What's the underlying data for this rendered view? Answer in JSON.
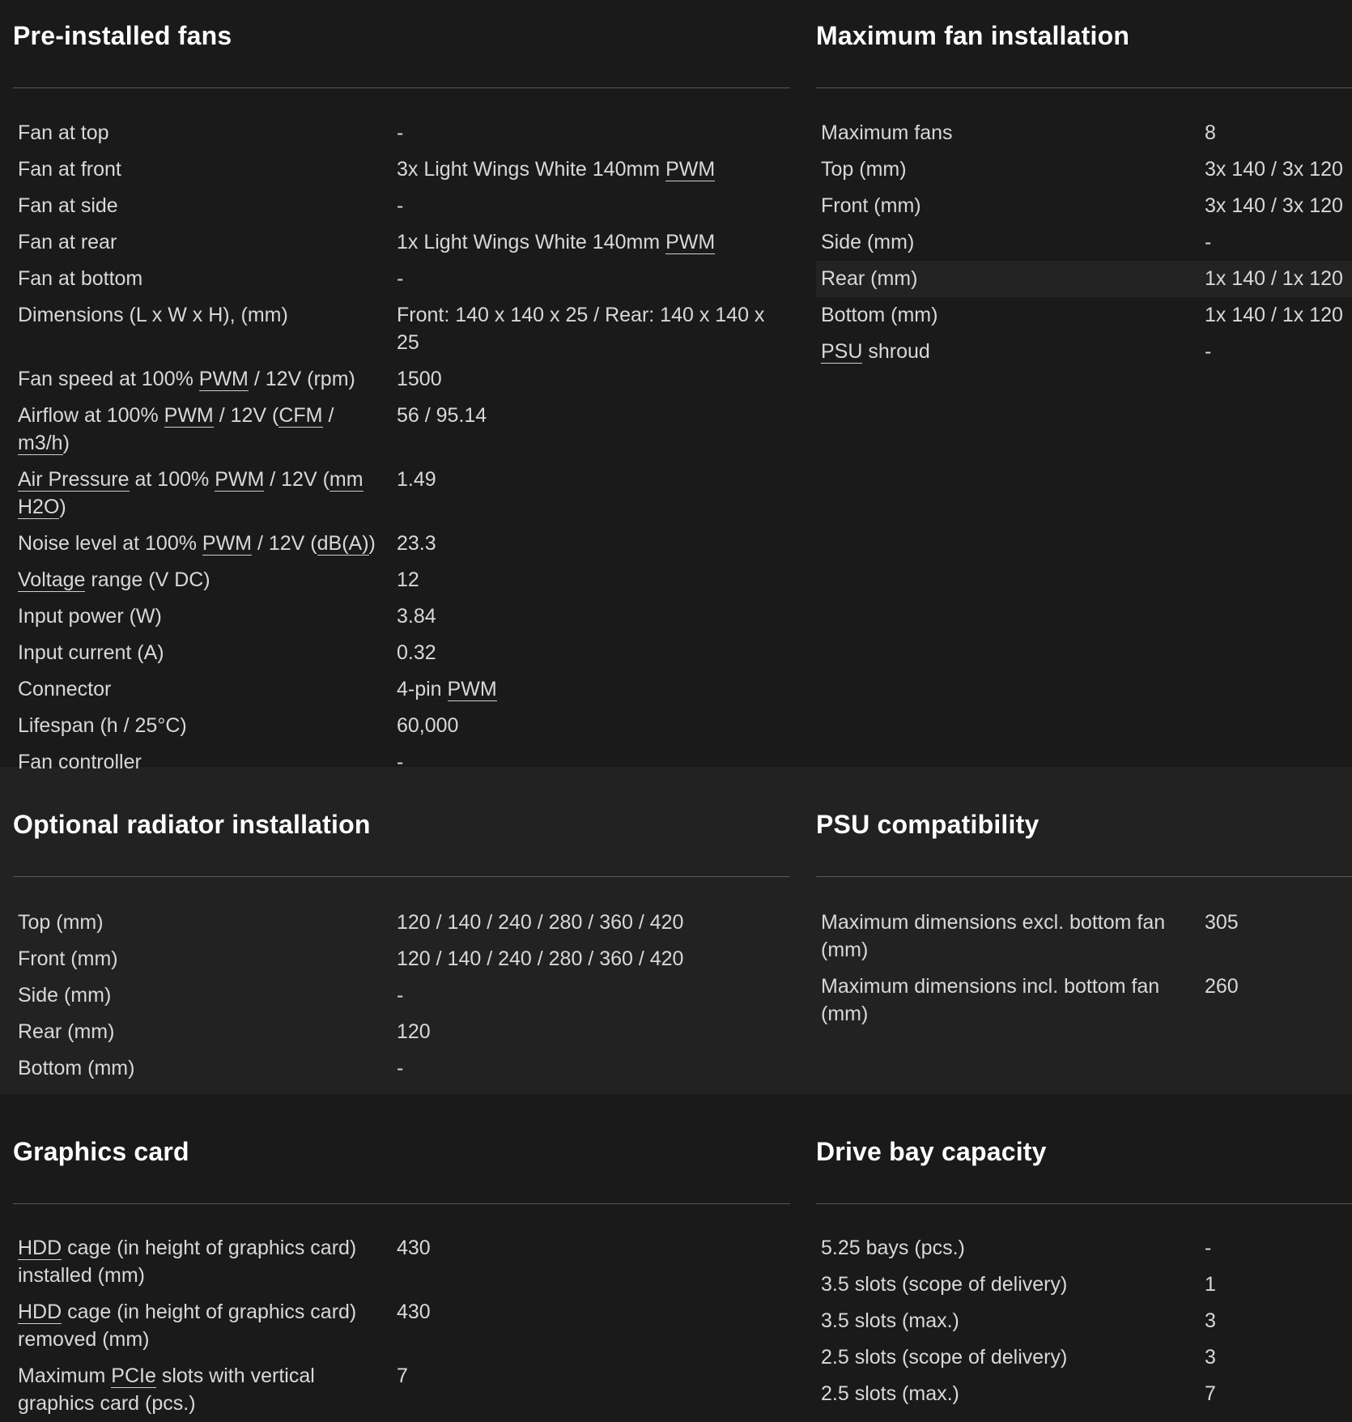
{
  "sections": {
    "preinstalled": {
      "title": "Pre-installed fans",
      "rows": [
        {
          "label": "Fan at top",
          "value": "-"
        },
        {
          "label": "Fan at front",
          "value_pre": "3x Light Wings White 140mm ",
          "value_abbr": "PWM"
        },
        {
          "label": "Fan at side",
          "value": "-"
        },
        {
          "label": "Fan at rear",
          "value_pre": "1x Light Wings White 140mm ",
          "value_abbr": "PWM"
        },
        {
          "label": "Fan at bottom",
          "value": "-"
        },
        {
          "label": "Dimensions (L x W x H), (mm)",
          "value": "Front: 140 x 140 x 25 / Rear: 140 x 140 x 25"
        },
        {
          "label_pre": "Fan speed at 100% ",
          "label_abbr": "PWM",
          "label_post": " / 12V (rpm)",
          "value": "1500"
        },
        {
          "label_pre": "Airflow at 100% ",
          "label_abbr": "PWM",
          "label_mid": " / 12V (",
          "label_abbr2": "CFM",
          "label_mid2": " / ",
          "label_abbr3": "m3/h",
          "label_post": ")",
          "value": "56 / 95.14"
        },
        {
          "label_abbr0": "Air Pressure",
          "label_pre": " at 100% ",
          "label_abbr": "PWM",
          "label_mid": " / 12V (",
          "label_abbr2": "mm H2O",
          "label_post": ")",
          "value": "1.49"
        },
        {
          "label_pre": "Noise level at 100% ",
          "label_abbr": "PWM",
          "label_mid": " / 12V (",
          "label_abbr2": "dB(A)",
          "label_post": ")",
          "value": "23.3"
        },
        {
          "label_abbr0": "Voltage",
          "label_post": " range (V DC)",
          "value": "12"
        },
        {
          "label": "Input power (W)",
          "value": "3.84"
        },
        {
          "label": "Input current (A)",
          "value": "0.32"
        },
        {
          "label": "Connector",
          "value_pre": "4-pin ",
          "value_abbr": "PWM"
        },
        {
          "label": "Lifespan (h / 25°C)",
          "value": "60,000"
        },
        {
          "label": "Fan controller",
          "value": "-"
        }
      ]
    },
    "maxfan": {
      "title": "Maximum fan installation",
      "rows": [
        {
          "label": "Maximum fans",
          "value": "8"
        },
        {
          "label": "Top (mm)",
          "value": "3x 140 / 3x 120"
        },
        {
          "label": "Front (mm)",
          "value": "3x 140 / 3x 120"
        },
        {
          "label": "Side (mm)",
          "value": "-"
        },
        {
          "label": "Rear (mm)",
          "value": "1x 140 / 1x 120"
        },
        {
          "label": "Bottom (mm)",
          "value": "1x 140 / 1x 120"
        },
        {
          "label_abbr0": "PSU",
          "label_post": " shroud",
          "value": "-"
        }
      ]
    },
    "radiator": {
      "title": "Optional radiator installation",
      "rows": [
        {
          "label": "Top (mm)",
          "value": "120 / 140 / 240 / 280 / 360 / 420"
        },
        {
          "label": "Front (mm)",
          "value": "120 / 140 / 240 / 280 / 360 / 420"
        },
        {
          "label": "Side (mm)",
          "value": "-"
        },
        {
          "label": "Rear (mm)",
          "value": "120"
        },
        {
          "label": "Bottom (mm)",
          "value": "-"
        }
      ]
    },
    "psu": {
      "title": "PSU compatibility",
      "rows": [
        {
          "label": "Maximum dimensions excl. bottom fan (mm)",
          "value": "305"
        },
        {
          "label": "Maximum dimensions incl. bottom fan (mm)",
          "value": "260"
        }
      ]
    },
    "graphics": {
      "title": "Graphics card",
      "rows": [
        {
          "label_abbr0": "HDD",
          "label_post": " cage (in height of graphics card) installed (mm)",
          "value": "430"
        },
        {
          "label_abbr0": "HDD",
          "label_post": " cage (in height of graphics card) removed (mm)",
          "value": "430"
        },
        {
          "label_pre": "Maximum ",
          "label_abbr": "PCIe",
          "label_post": " slots with vertical graphics card (pcs.)",
          "value": "7"
        }
      ]
    },
    "drivebay": {
      "title": "Drive bay capacity",
      "rows": [
        {
          "label": "5.25 bays (pcs.)",
          "value": "-"
        },
        {
          "label": "3.5 slots (scope of delivery)",
          "value": "1"
        },
        {
          "label": "3.5 slots (max.)",
          "value": "3"
        },
        {
          "label": "2.5 slots (scope of delivery)",
          "value": "3"
        },
        {
          "label": "2.5 slots (max.)",
          "value": "7"
        }
      ]
    }
  },
  "colors": {
    "background": "#1a1a1a",
    "band_alt": "#222222",
    "text": "#d8d8d8",
    "title": "#ffffff",
    "rule": "#5a5a5a",
    "highlight_row": "#232323"
  }
}
